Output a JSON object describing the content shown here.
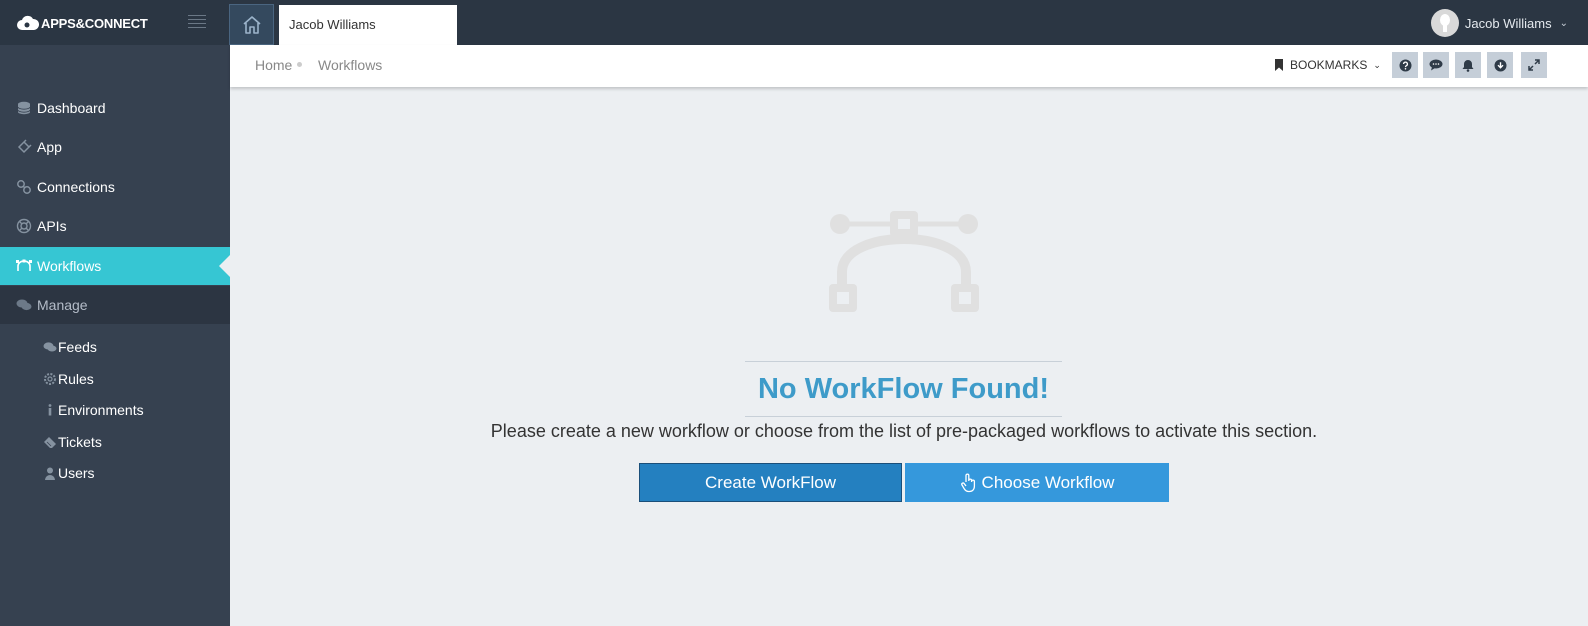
{
  "app": {
    "logo_text": "APPS&CONNECT"
  },
  "header": {
    "open_tab_label": "Jacob Williams",
    "user_name": "Jacob Williams"
  },
  "sidebar": {
    "items": [
      {
        "label": "Dashboard",
        "icon": "database-icon"
      },
      {
        "label": "App",
        "icon": "puzzle-icon"
      },
      {
        "label": "Connections",
        "icon": "link-icon"
      },
      {
        "label": "APIs",
        "icon": "lifebuoy-icon"
      },
      {
        "label": "Workflows",
        "icon": "workflow-icon",
        "active": true
      },
      {
        "label": "Manage",
        "icon": "chat-icon",
        "open": true
      }
    ],
    "sub_items": [
      {
        "label": "Feeds",
        "icon": "comments-icon"
      },
      {
        "label": "Rules",
        "icon": "gear-icon"
      },
      {
        "label": "Environments",
        "icon": "info-icon"
      },
      {
        "label": "Tickets",
        "icon": "ticket-icon"
      },
      {
        "label": "Users",
        "icon": "user-icon"
      }
    ]
  },
  "breadcrumb": {
    "home": "Home",
    "current": "Workflows"
  },
  "toolbar": {
    "bookmarks_label": "BOOKMARKS"
  },
  "empty_state": {
    "title": "No WorkFlow Found!",
    "message": "Please create a new workflow or choose from the list of pre-packaged workflows to activate this section.",
    "create_button": "Create WorkFlow",
    "choose_button": "Choose Workflow"
  },
  "colors": {
    "topbar": "#2b3643",
    "sidebar": "#364150",
    "active": "#36c6d3",
    "title": "#3e9bc9",
    "create_button": "#2480c0",
    "choose_button": "#3598dc"
  }
}
